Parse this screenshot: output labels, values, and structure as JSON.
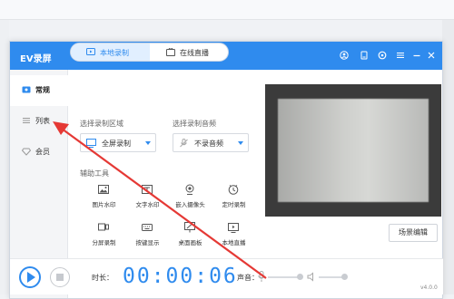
{
  "app": {
    "title": "EV录屏"
  },
  "sidebar": {
    "items": [
      {
        "label": "常规",
        "icon": "record-icon"
      },
      {
        "label": "列表",
        "icon": "list-icon"
      },
      {
        "label": "会员",
        "icon": "gem-icon"
      }
    ],
    "active_index": 0
  },
  "modes": [
    {
      "label": "本地录制",
      "icon": "screen-record-icon",
      "active": true
    },
    {
      "label": "在线直播",
      "icon": "live-icon",
      "active": false
    }
  ],
  "region": {
    "label": "选择录制区域",
    "value": "全屏录制"
  },
  "audio": {
    "label": "选择录制音频",
    "value": "不录音频"
  },
  "tools": {
    "label": "辅助工具",
    "items": [
      {
        "label": "图片水印",
        "icon": "image-icon"
      },
      {
        "label": "文字水印",
        "icon": "text-icon"
      },
      {
        "label": "嵌入摄像头",
        "icon": "camera-icon"
      },
      {
        "label": "定时录制",
        "icon": "clock-icon"
      },
      {
        "label": "分屏录制",
        "icon": "split-screen-icon"
      },
      {
        "label": "按键显示",
        "icon": "keyboard-icon"
      },
      {
        "label": "桌面画板",
        "icon": "paint-icon"
      },
      {
        "label": "本地直播",
        "icon": "local-live-icon"
      }
    ]
  },
  "preview": {
    "scene_button": "场景编辑"
  },
  "bottom": {
    "time_label": "时长：",
    "timer": "00:00:06",
    "volume_label": "声音：",
    "version": "v4.0.0"
  },
  "colors": {
    "accent": "#2f8bee",
    "annotation": "#e53935"
  }
}
